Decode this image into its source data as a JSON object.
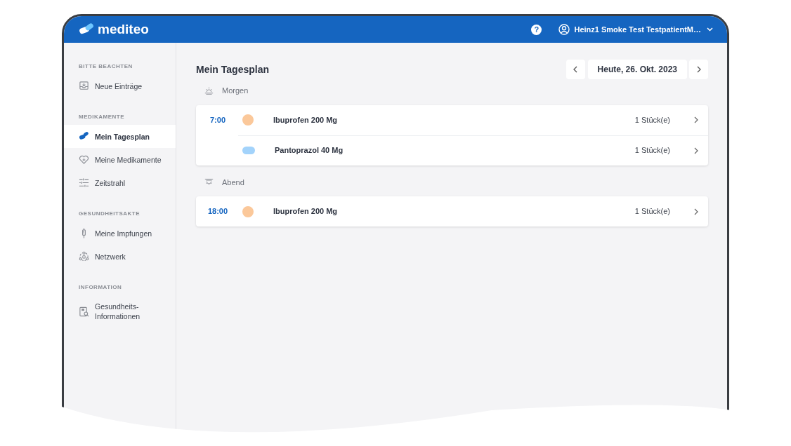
{
  "header": {
    "logo": "mediteo",
    "help": "?",
    "user": "Heinz1 Smoke Test TestpatientM…"
  },
  "sidebar": {
    "sections": [
      {
        "title": "BITTE BEACHTEN",
        "items": [
          {
            "label": "Neue Einträge",
            "kind": "inbox",
            "selected": false
          }
        ]
      },
      {
        "title": "MEDIKAMENTE",
        "items": [
          {
            "label": "Mein Tagesplan",
            "kind": "pills",
            "selected": true
          },
          {
            "label": "Meine Medikamente",
            "kind": "heart",
            "selected": false
          },
          {
            "label": "Zeitstrahl",
            "kind": "timeline",
            "selected": false
          }
        ]
      },
      {
        "title": "GESUNDHEITSAKTE",
        "items": [
          {
            "label": "Meine Impfungen",
            "kind": "syringe",
            "selected": false
          },
          {
            "label": "Netzwerk",
            "kind": "network",
            "selected": false
          }
        ]
      },
      {
        "title": "INFORMATION",
        "items": [
          {
            "label": "Gesundheits-\nInformationen",
            "kind": "book",
            "selected": false
          }
        ]
      }
    ]
  },
  "main": {
    "title": "Mein Tagesplan",
    "date": "Heute, 26. Okt. 2023",
    "periods": [
      {
        "label": "Morgen",
        "kind": "sunrise",
        "groups": [
          {
            "time": "7:00",
            "meds": [
              {
                "name": "Ibuprofen 200 Mg",
                "amount": "1 Stück(e)",
                "kind": "round",
                "color": "#fbc89a"
              },
              {
                "name": "Pantoprazol 40 Mg",
                "amount": "1 Stück(e)",
                "kind": "oval",
                "color": "#a3d3fb"
              }
            ]
          }
        ]
      },
      {
        "label": "Abend",
        "kind": "sunset",
        "groups": [
          {
            "time": "18:00",
            "meds": [
              {
                "name": "Ibuprofen 200 Mg",
                "amount": "1 Stück(e)",
                "kind": "round",
                "color": "#fbc89a"
              }
            ]
          }
        ]
      }
    ]
  }
}
